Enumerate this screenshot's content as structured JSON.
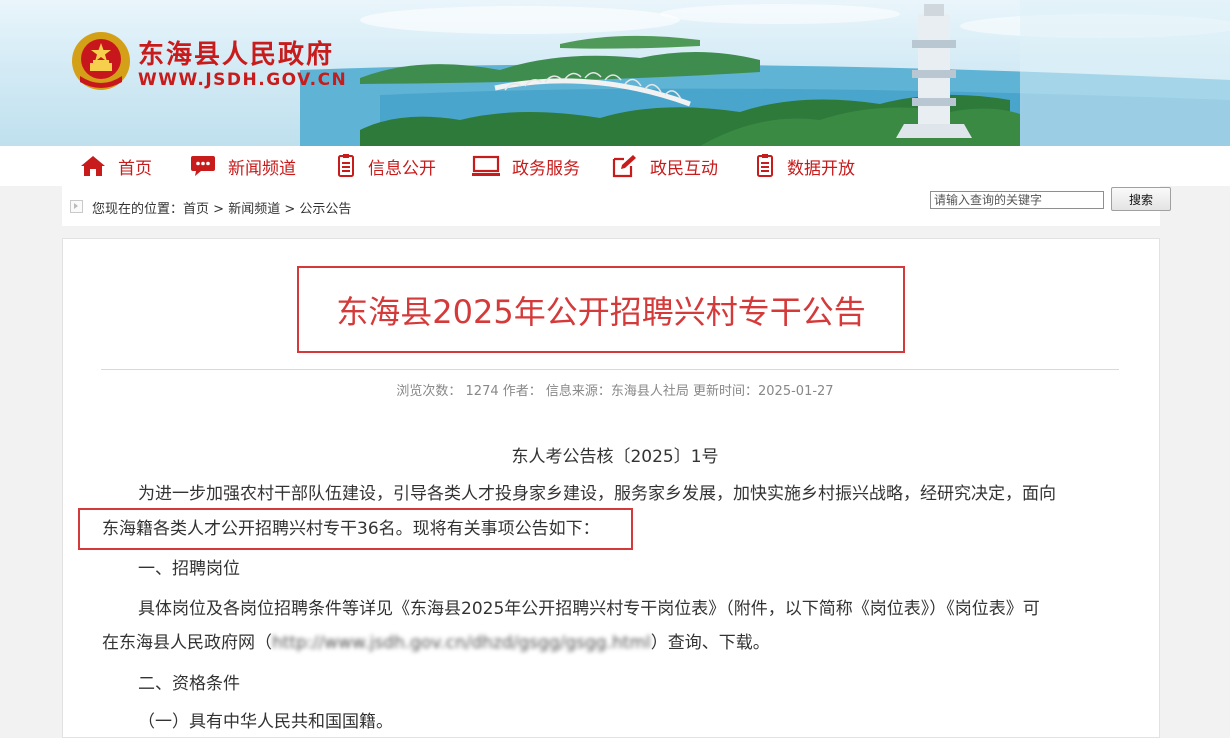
{
  "site": {
    "name": "东海县人民政府",
    "url": "WWW.JSDH.GOV.CN"
  },
  "nav": [
    {
      "label": "首页",
      "icon": "home-icon"
    },
    {
      "label": "新闻频道",
      "icon": "chat-bubble-icon"
    },
    {
      "label": "信息公开",
      "icon": "document-list-icon"
    },
    {
      "label": "政务服务",
      "icon": "monitor-icon"
    },
    {
      "label": "政民互动",
      "icon": "edit-icon"
    },
    {
      "label": "数据开放",
      "icon": "data-list-icon"
    }
  ],
  "breadcrumb": {
    "prefix": "您现在的位置：",
    "items": [
      "首页",
      "新闻频道",
      "公示公告"
    ],
    "separator": " > "
  },
  "search": {
    "placeholder": "请输入查询的关键字",
    "button_label": "搜索"
  },
  "article": {
    "title": "东海县2025年公开招聘兴村专干公告",
    "meta": "浏览次数：  1274 作者：  信息来源：东海县人社局 更新时间：2025-01-27",
    "doc_number": "东人考公告核〔2025〕1号",
    "intro_line1": "为进一步加强农村干部队伍建设，引导各类人才投身家乡建设，服务家乡发展，加快实施乡村振兴战略，经研究决定，面向",
    "intro_line2": "东海籍各类人才公开招聘兴村专干36名。现将有关事项公告如下：",
    "section1_heading": "一、招聘岗位",
    "section1_line1": "具体岗位及各岗位招聘条件等详见《东海县2025年公开招聘兴村专干岗位表》（附件，以下简称《岗位表》）《岗位表》可",
    "section1_line2_prefix": "在东海县人民政府网（",
    "section1_line2_link": "http://www.jsdh.gov.cn/dhzd/gsgg/gsgg.html",
    "section1_line2_suffix": "）查询、下载。",
    "section2_heading": "二、资格条件",
    "section2_item1": "（一）具有中华人民共和国国籍。"
  },
  "colors": {
    "brand_red": "#c81b1b",
    "title_red": "#d53a3a",
    "highlight_border": "#d53a3a"
  }
}
